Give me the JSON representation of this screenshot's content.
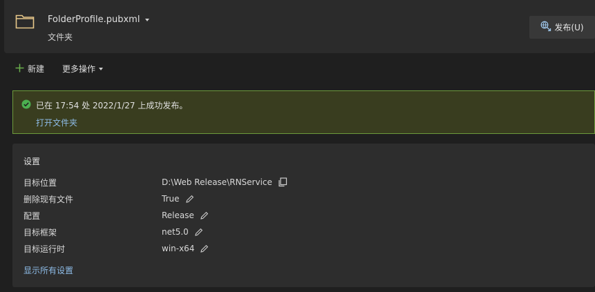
{
  "header": {
    "title": "FolderProfile.pubxml",
    "subtitle": "文件夹",
    "publish_label": "发布(U)"
  },
  "toolbar": {
    "new_label": "新建",
    "more_label": "更多操作"
  },
  "banner": {
    "message": "已在 17:54 处 2022/1/27 上成功发布。",
    "link": "打开文件夹"
  },
  "settings": {
    "title": "设置",
    "rows": [
      {
        "label": "目标位置",
        "value": "D:\\Web Release\\RNService",
        "icon": "copy-icon"
      },
      {
        "label": "删除现有文件",
        "value": "True",
        "icon": "pencil-icon"
      },
      {
        "label": "配置",
        "value": "Release",
        "icon": "pencil-icon"
      },
      {
        "label": "目标框架",
        "value": "net5.0",
        "icon": "pencil-icon"
      },
      {
        "label": "目标运行时",
        "value": "win-x64",
        "icon": "pencil-icon"
      }
    ],
    "show_all": "显示所有设置"
  },
  "colors": {
    "success_border": "#6c9b3c",
    "success_bg": "#393d1f",
    "success_icon": "#4caf50",
    "link": "#8dbbe6",
    "add_icon": "#6ab04c"
  }
}
